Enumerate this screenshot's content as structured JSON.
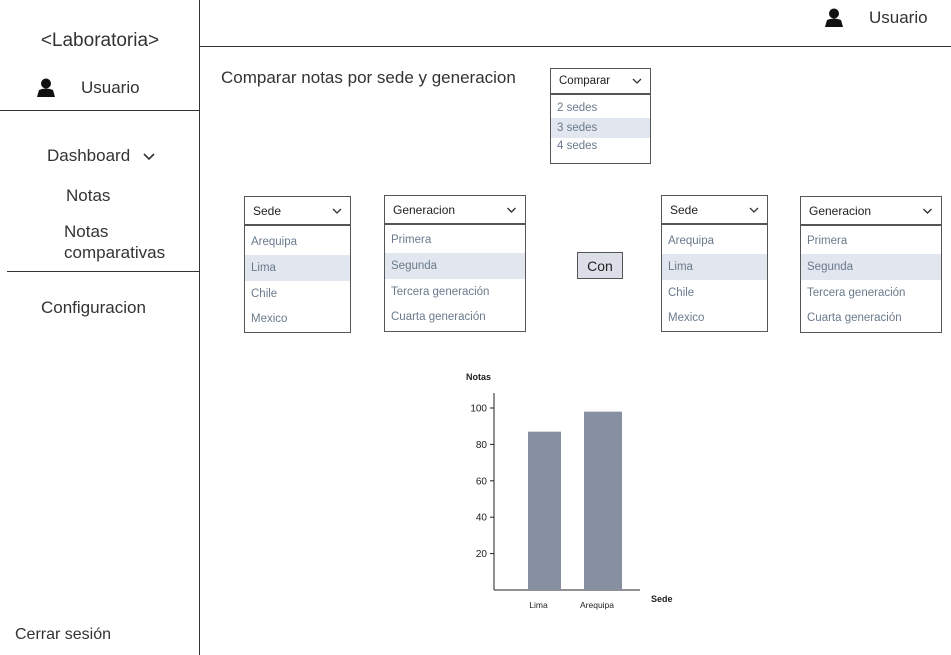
{
  "app": {
    "brand": "<Laboratoria>"
  },
  "sidebar": {
    "user_label": "Usuario",
    "nav": {
      "dashboard": "Dashboard",
      "notas": "Notas",
      "notas_comparativas_line1": "Notas",
      "notas_comparativas_line2": "comparativas",
      "configuracion": "Configuracion"
    },
    "logout": "Cerrar sesión"
  },
  "topbar": {
    "user_label": "Usuario"
  },
  "page": {
    "title": "Comparar notas por sede y generacion"
  },
  "compare_dropdown": {
    "value": "Comparar",
    "options": [
      "2 sedes",
      "3 sedes",
      "4 sedes"
    ],
    "highlighted_index": 1
  },
  "left_sede": {
    "value": "Sede",
    "options": [
      "Arequipa",
      "Lima",
      "Chile",
      "Mexico"
    ],
    "highlighted_index": 1
  },
  "left_generacion": {
    "value": "Generacion",
    "options": [
      "Primera",
      "Segunda",
      "Tercera generación",
      "Cuarta generación"
    ],
    "highlighted_index": 1
  },
  "con_button": "Con",
  "right_sede": {
    "value": "Sede",
    "options": [
      "Arequipa",
      "Lima",
      "Chile",
      "Mexico"
    ],
    "highlighted_index": 1
  },
  "right_generacion": {
    "value": "Generacion",
    "options": [
      "Primera",
      "Segunda",
      "Tercera generación",
      "Cuarta generación"
    ],
    "highlighted_index": 1
  },
  "colors": {
    "bar": "#8690a0",
    "highlight": "#e2e6ee"
  },
  "chart_data": {
    "type": "bar",
    "categories": [
      "Lima",
      "Arequipa"
    ],
    "values": [
      87,
      98
    ],
    "xlabel": "Sede",
    "ylabel": "Notas",
    "yticks": [
      20,
      40,
      60,
      80,
      100
    ],
    "ylim": [
      0,
      110
    ],
    "grid": false
  }
}
